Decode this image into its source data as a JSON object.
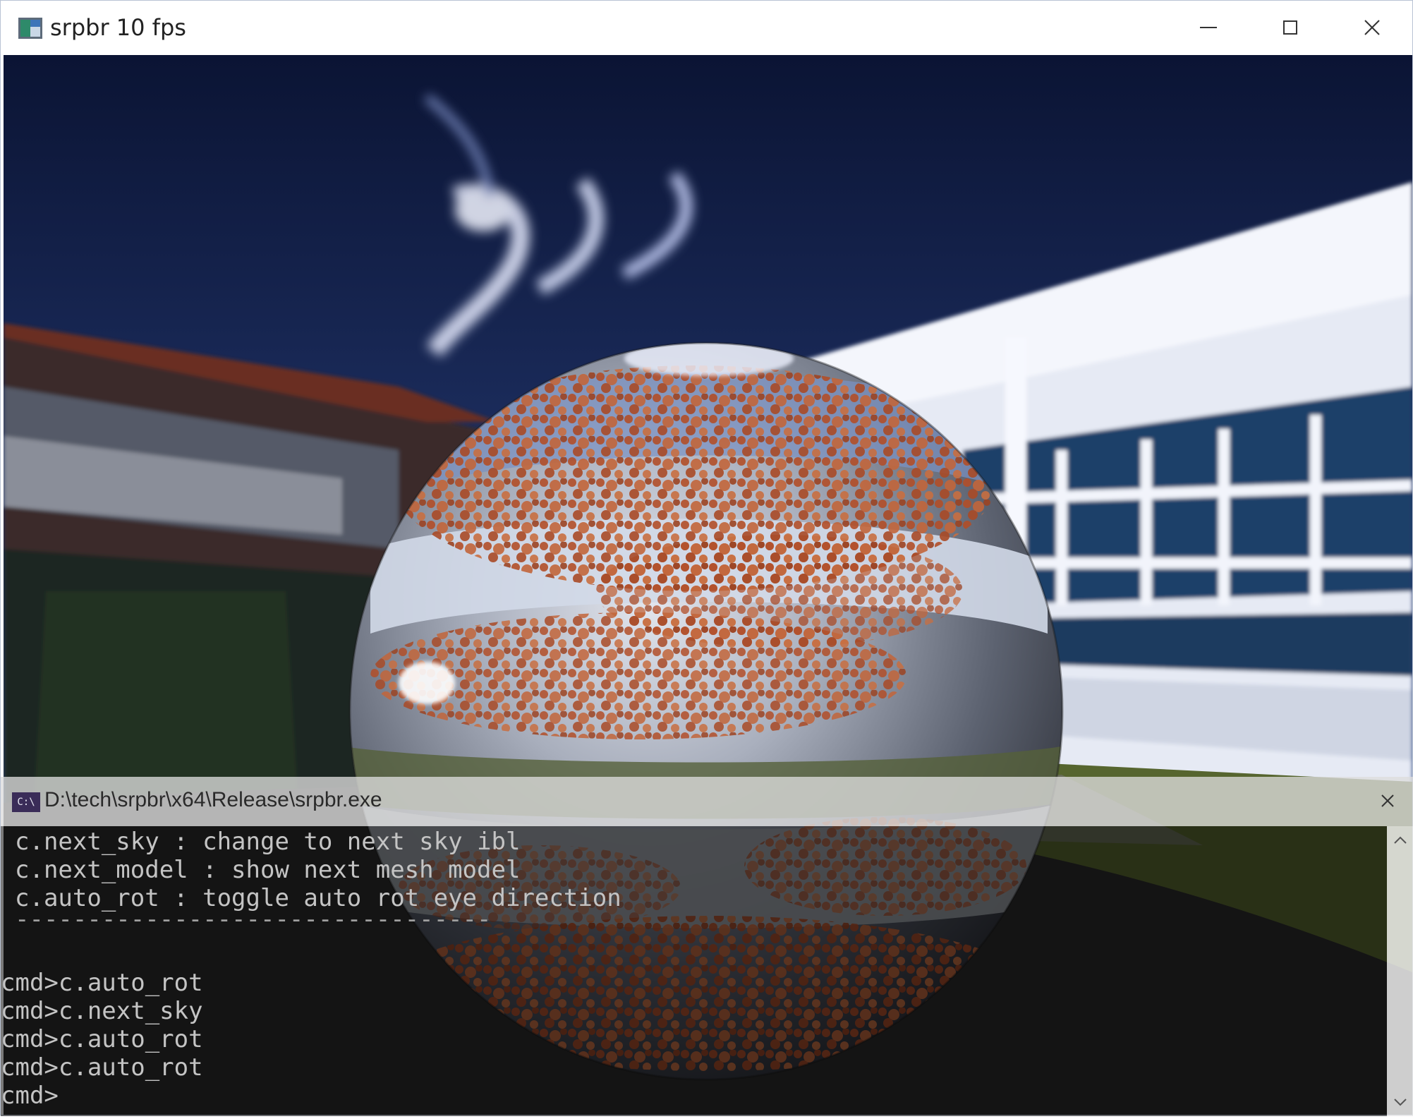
{
  "window": {
    "title": "srpbr 10 fps",
    "controls": [
      "minimize",
      "maximize",
      "close"
    ]
  },
  "console": {
    "title": "D:\\tech\\srpbr\\x64\\Release\\srpbr.exe",
    "icon_text": "C:\\",
    "help_lines": [
      "c.next_sky : change to next sky ibl",
      "c.next_model : show next mesh model",
      "c.auto_rot : toggle auto rot eye direction"
    ],
    "separator": "---------------------------------",
    "history": [
      "cmd>c.auto_rot",
      "cmd>c.next_sky",
      "cmd>c.auto_rot",
      "cmd>c.auto_rot",
      "cmd>"
    ]
  },
  "colors": {
    "sky_top": "#0f1a42",
    "sky_mid": "#23386e",
    "building": "#f2f4fb",
    "windows": "#183e68",
    "rust": "#b5512c",
    "chrome": "#c8ccd6",
    "ground": "#2a2a2a",
    "grass": "#5a6b2e"
  }
}
